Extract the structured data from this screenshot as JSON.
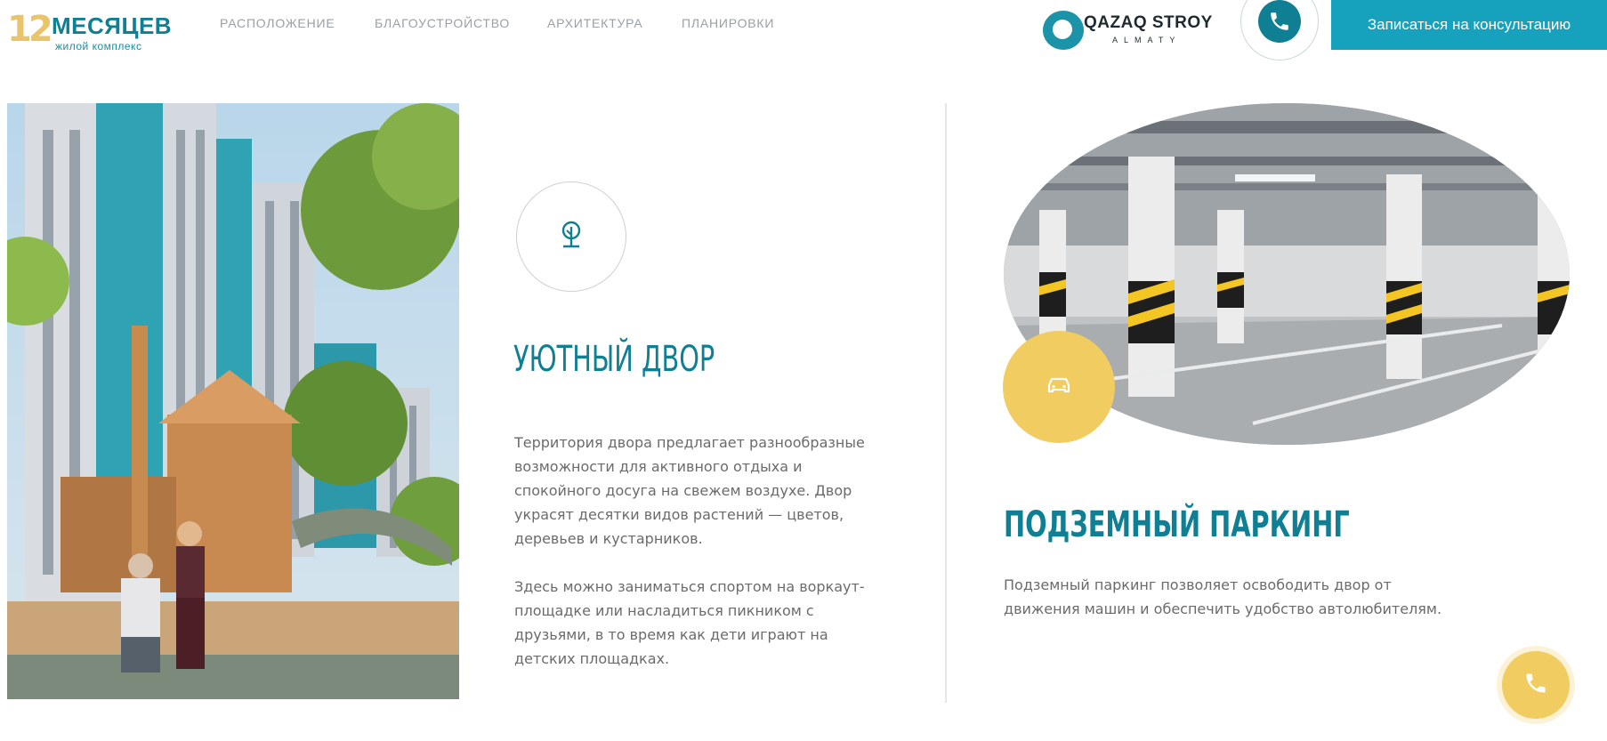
{
  "header": {
    "logo": {
      "number": "12",
      "title": "МЕСЯЦЕВ",
      "subtitle": "жилой комплекс"
    },
    "nav": [
      {
        "label": "РАСПОЛОЖЕНИЕ"
      },
      {
        "label": "БЛАГОУСТРОЙСТВО"
      },
      {
        "label": "АРХИТЕКТУРА"
      },
      {
        "label": "ПЛАНИРОВКИ"
      }
    ],
    "partner_logo": {
      "title": "QAZAQ STROY",
      "subtitle": "ALMATY"
    },
    "phone_icon": "phone-icon",
    "cta_label": "Записаться на консультацию"
  },
  "yard": {
    "icon": "tree-icon",
    "title": "УЮТНЫЙ ДВОР",
    "paragraphs": [
      "Территория двора предлагает разнообразные возможности для активного отдыха и спокойного досуга на свежем воздухе. Двор украсят десятки видов растений — цветов, деревьев и кустарников.",
      "Здесь можно заниматься спортом на воркаут-площадке или насладиться пикником с друзьями, в то время как дети играют на детских площадках."
    ]
  },
  "parking": {
    "icon": "car-icon",
    "title": "ПОДЗЕМНЫЙ ПАРКИНГ",
    "text": "Подземный паркинг позволяет освободить двор от движения машин и обеспечить удобство автолюбителям."
  },
  "colors": {
    "brand": "#0f7f93",
    "accent": "#16a2bd",
    "gold": "#f1cc61"
  }
}
